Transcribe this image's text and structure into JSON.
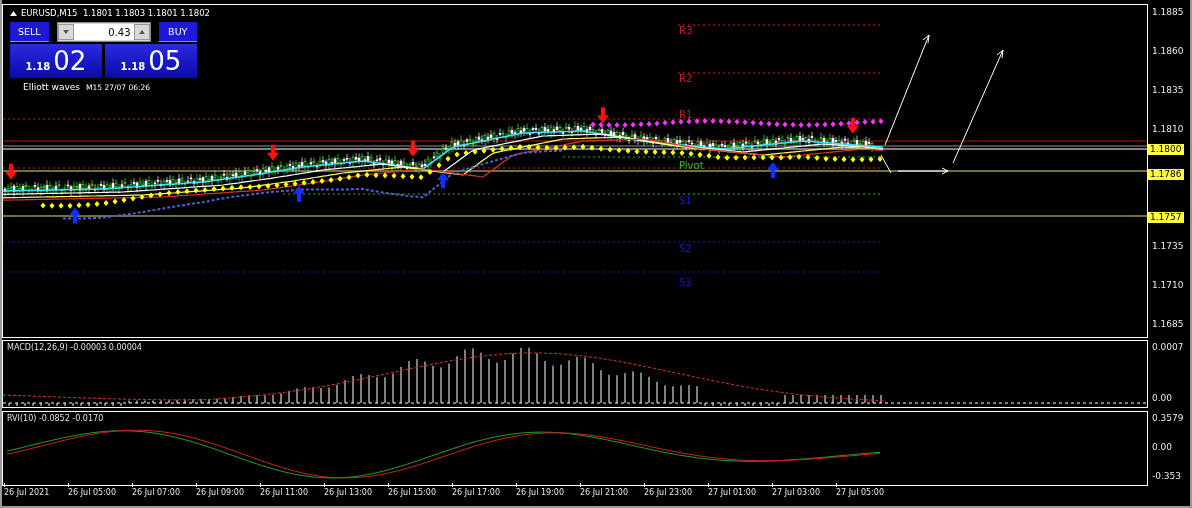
{
  "symbol_header": {
    "text": "EURUSD,M15  1.1801 1.1803 1.1801 1.1802"
  },
  "trade_panel": {
    "sell_label": "SELL",
    "buy_label": "BUY",
    "lot": "0.43",
    "sell_price": {
      "prefix": "1.18",
      "digits": "02"
    },
    "buy_price": {
      "prefix": "1.18",
      "digits": "05"
    }
  },
  "indicator_title": {
    "name": "Elliott waves",
    "info": "M15 27/07 06:26"
  },
  "pivot_labels": [
    {
      "text": "R3",
      "kind": "resistance"
    },
    {
      "text": "R2",
      "kind": "resistance"
    },
    {
      "text": "R1",
      "kind": "resistance"
    },
    {
      "text": "Pivot",
      "kind": "pivot"
    },
    {
      "text": "S1",
      "kind": "support"
    },
    {
      "text": "S2",
      "kind": "support"
    },
    {
      "text": "S3",
      "kind": "support"
    }
  ],
  "price_axis": [
    "1.1885",
    "1.1860",
    "1.1835",
    "1.1810",
    "1.1735",
    "1.1710",
    "1.1685"
  ],
  "price_tags": [
    "1.1800",
    "1.1786",
    "1.1757"
  ],
  "macd": {
    "label": "MACD(12,26,9) -0.00003 0.00004",
    "axis": [
      "0.0007",
      "0.00"
    ]
  },
  "rvi": {
    "label": "RVI(10) -0.0852 -0.0170",
    "axis": [
      "0.3579",
      "0.00",
      "-0.353"
    ]
  },
  "time_axis": [
    "26 Jul 2021",
    "26 Jul 05:00",
    "26 Jul 07:00",
    "26 Jul 09:00",
    "26 Jul 11:00",
    "26 Jul 13:00",
    "26 Jul 15:00",
    "26 Jul 17:00",
    "26 Jul 19:00",
    "26 Jul 21:00",
    "26 Jul 23:00",
    "27 Jul 01:00",
    "27 Jul 03:00",
    "27 Jul 05:00"
  ]
}
